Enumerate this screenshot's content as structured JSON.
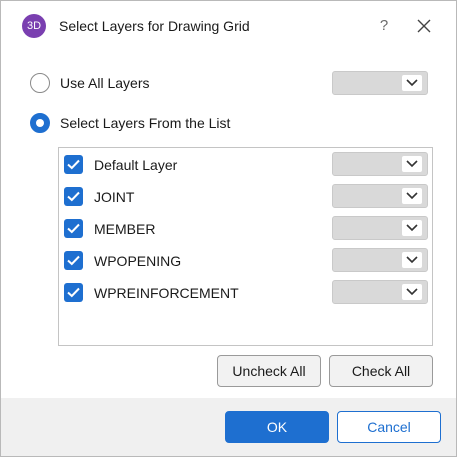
{
  "window": {
    "app_icon_text": "3D",
    "title": "Select Layers for Drawing Grid",
    "help_glyph": "?"
  },
  "options": {
    "use_all": {
      "label": "Use All Layers",
      "selected": false
    },
    "select_from_list": {
      "label": "Select Layers From the List",
      "selected": true
    }
  },
  "layers": [
    {
      "label": "Default Layer",
      "checked": true
    },
    {
      "label": "JOINT",
      "checked": true
    },
    {
      "label": "MEMBER",
      "checked": true
    },
    {
      "label": "WPOPENING",
      "checked": true
    },
    {
      "label": "WPREINFORCEMENT",
      "checked": true
    }
  ],
  "buttons": {
    "uncheck_all": "Uncheck All",
    "check_all": "Check All",
    "ok": "OK",
    "cancel": "Cancel"
  },
  "colors": {
    "accent": "#1e6fd0",
    "app_icon": "#7a3fb0",
    "dropdown_bg": "#d9d9d9"
  }
}
